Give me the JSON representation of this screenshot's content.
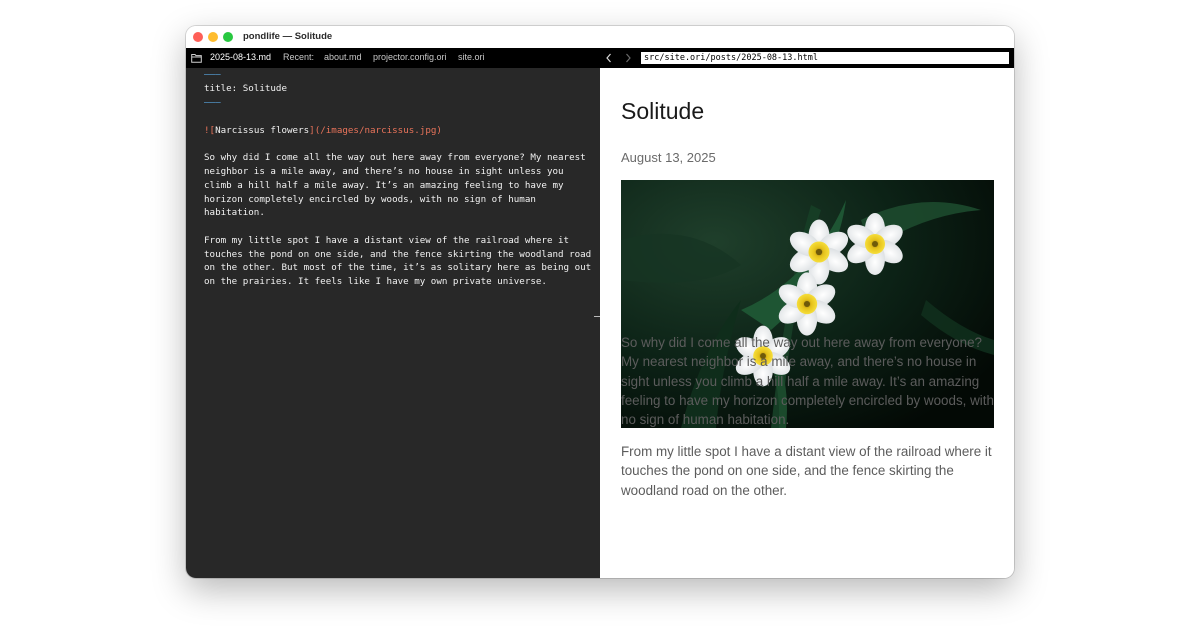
{
  "window": {
    "title": "pondlife — Solitude"
  },
  "toolbar": {
    "current_file": "2025-08-13.md",
    "recent_label": "Recent:",
    "recent_files": [
      "about.md",
      "projector.config.ori",
      "site.ori"
    ],
    "url_value": "src/site.ori/posts/2025-08-13.html"
  },
  "editor": {
    "fm_open": "———",
    "fm_title_key": "title:",
    "fm_title_value": " Solitude",
    "fm_close": "———",
    "img_bang": "!",
    "img_open": "[",
    "img_alt": "Narcissus flowers",
    "img_close": "]",
    "img_url": "(/images/narcissus.jpg)",
    "para1_lines": [
      "So why did I come all the way out here away from everyone? My nearest",
      "neighbor is a mile away, and there’s no house in sight unless you",
      "climb a hill half a mile away. It’s an amazing feeling to have my",
      "horizon completely encircled by woods, with no sign of human",
      "habitation."
    ],
    "para2_lines": [
      "From my little spot I have a distant view of the railroad where it",
      "touches the pond on one side, and the fence skirting the woodland road",
      "on the other. But most of the time, it’s as solitary here as being out",
      "on the prairies. It feels like I have my own private universe."
    ]
  },
  "preview": {
    "title": "Solitude",
    "date": "August 13, 2025",
    "image_alt": "Narcissus flowers",
    "para1": "So why did I come all the way out here away from everyone? My nearest neighbor is a mile away, and there’s no house in sight unless you climb a hill half a mile away. It’s an amazing feeling to have my horizon completely encircled by woods, with no sign of human habitation.",
    "para2": "From my little spot I have a distant view of the railroad where it touches the pond on one side, and the fence skirting the woodland road on the other."
  },
  "colors": {
    "editor_bg": "#282828",
    "toolbar_bg": "#000000",
    "frontmatter_dash": "#5aa9e6",
    "markdown_link": "#e8735a",
    "traffic_red": "#fe5f57",
    "traffic_yellow": "#febc2e",
    "traffic_green": "#28c840"
  },
  "icons": {
    "folder": "folder-icon",
    "back": "chevron-left-icon",
    "forward": "chevron-right-icon"
  }
}
